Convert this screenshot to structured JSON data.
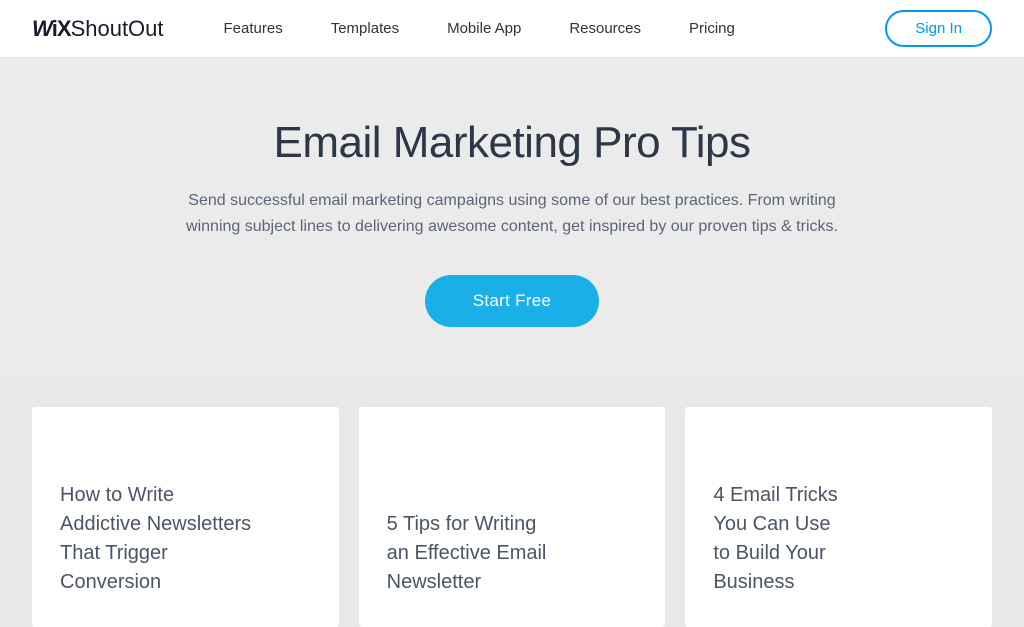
{
  "header": {
    "logo_wix": "WiX",
    "logo_shoutout": "ShoutOut",
    "nav": {
      "items": [
        {
          "label": "Features",
          "id": "features"
        },
        {
          "label": "Templates",
          "id": "templates"
        },
        {
          "label": "Mobile App",
          "id": "mobile-app"
        },
        {
          "label": "Resources",
          "id": "resources"
        },
        {
          "label": "Pricing",
          "id": "pricing"
        }
      ]
    },
    "sign_in_label": "Sign In"
  },
  "hero": {
    "title": "Email Marketing Pro Tips",
    "subtitle": "Send successful email marketing campaigns using some of our best practices. From writing winning subject lines to delivering awesome content, get inspired by our proven tips & tricks.",
    "cta_label": "Start Free"
  },
  "cards": [
    {
      "id": "card-1",
      "title_line1": "How to Write",
      "title_line2": "Addictive Newsletters",
      "title_line3": "That Trigger",
      "title_line4": "Conversion"
    },
    {
      "id": "card-2",
      "title_line1": "5 Tips for Writing",
      "title_line2": "an Effective Email",
      "title_line3": "Newsletter",
      "title_line4": ""
    },
    {
      "id": "card-3",
      "title_line1": "4 Email Tricks",
      "title_line2": "You Can Use",
      "title_line3": "to Build Your",
      "title_line4": "Business"
    }
  ]
}
